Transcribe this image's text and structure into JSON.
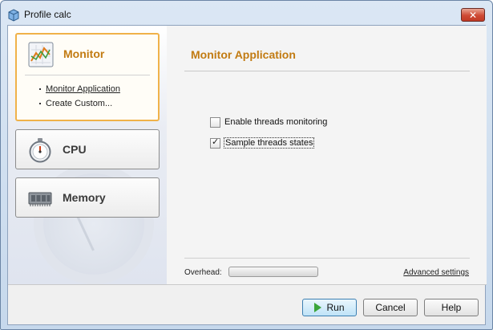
{
  "window": {
    "title": "Profile calc",
    "close_glyph": "✕"
  },
  "categories": [
    {
      "label": "Monitor",
      "icon": "monitor-chart-icon",
      "active": true,
      "items": [
        {
          "label": "Monitor Application",
          "selected": true
        },
        {
          "label": "Create Custom...",
          "selected": false
        }
      ]
    },
    {
      "label": "CPU",
      "icon": "stopwatch-icon",
      "active": false
    },
    {
      "label": "Memory",
      "icon": "memory-chip-icon",
      "active": false
    }
  ],
  "main": {
    "title": "Monitor Application",
    "options": [
      {
        "label": "Enable threads monitoring",
        "checked": false
      },
      {
        "label": "Sample threads states",
        "checked": true
      }
    ],
    "overhead_label": "Overhead:",
    "advanced_link": "Advanced settings"
  },
  "buttons": {
    "run": "Run",
    "cancel": "Cancel",
    "help": "Help"
  },
  "colors": {
    "accent": "#c27b12",
    "active_border": "#f0b24a",
    "primary_button": "#bfe3f7"
  }
}
